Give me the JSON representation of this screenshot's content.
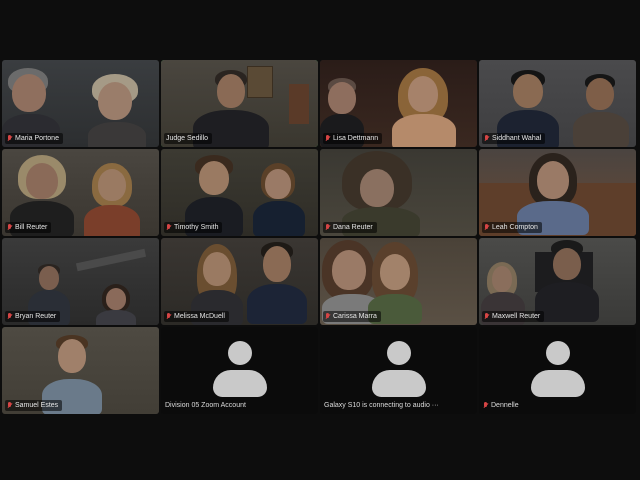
{
  "tiles": [
    {
      "name": "Maria Portone",
      "muted": true
    },
    {
      "name": "Judge Sedillo",
      "muted": false,
      "active": true
    },
    {
      "name": "Lisa Dettmann",
      "muted": true
    },
    {
      "name": "Siddhant Wahal",
      "muted": true
    },
    {
      "name": "Bill Reuter",
      "muted": true
    },
    {
      "name": "Timothy Smith",
      "muted": true
    },
    {
      "name": "Dana Reuter",
      "muted": true
    },
    {
      "name": "Leah Compton",
      "muted": true
    },
    {
      "name": "Bryan Reuter",
      "muted": true
    },
    {
      "name": "Melissa McDuell",
      "muted": true
    },
    {
      "name": "Carissa Marra",
      "muted": true
    },
    {
      "name": "Maxwell Reuter",
      "muted": true
    },
    {
      "name": "Samuel Estes",
      "muted": true
    },
    {
      "name": "Division 05 Zoom Account",
      "muted": false,
      "avatar": true
    },
    {
      "name": "Galaxy S10 is connecting to audio ···",
      "muted": false,
      "avatar": true
    },
    {
      "name": "Dennelle",
      "muted": true,
      "avatar": true
    }
  ],
  "colors": {
    "active_border": "#2a9a4a",
    "muted_mic": "#d64545",
    "background": "#0d0d0d"
  }
}
